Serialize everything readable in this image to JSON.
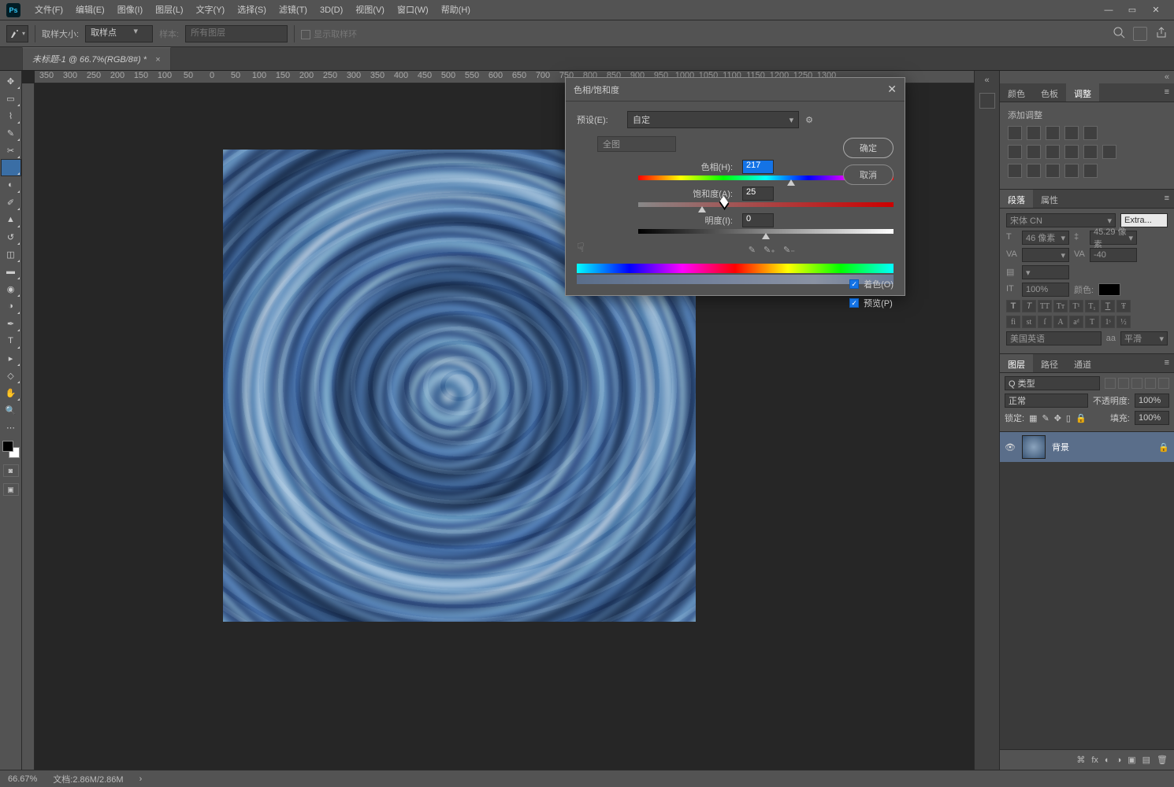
{
  "menu": {
    "items": [
      "文件(F)",
      "编辑(E)",
      "图像(I)",
      "图层(L)",
      "文字(Y)",
      "选择(S)",
      "滤镜(T)",
      "3D(D)",
      "视图(V)",
      "窗口(W)",
      "帮助(H)"
    ]
  },
  "options": {
    "sample_size_label": "取样大小:",
    "sample_size_value": "取样点",
    "sample_label": "样本:",
    "sample_value": "所有图层",
    "show_ring": "显示取样环"
  },
  "doc_tab": {
    "title": "未标题-1 @ 66.7%(RGB/8#) *"
  },
  "ruler": {
    "marks": [
      "350",
      "300",
      "250",
      "200",
      "150",
      "100",
      "50",
      "0",
      "50",
      "100",
      "150",
      "200",
      "250",
      "300",
      "350",
      "400",
      "450",
      "500",
      "550",
      "600",
      "650",
      "700",
      "750",
      "800",
      "850",
      "900",
      "950",
      "1000",
      "1050",
      "1100",
      "1150",
      "1200",
      "1250",
      "1300"
    ]
  },
  "panel_tabs": {
    "adjust": [
      "颜色",
      "色板",
      "调整"
    ],
    "prop": [
      "段落",
      "属性"
    ],
    "layers": [
      "图层",
      "路径",
      "通道"
    ]
  },
  "adjust": {
    "add_label": "添加调整"
  },
  "character": {
    "font": "宋体 CN",
    "style": "Extra...",
    "size": "46 像素",
    "leading": "45.29 像素",
    "tracking": "-40",
    "kerning": "",
    "color_label": "颜色:",
    "size_pct": "100%",
    "lang": "美国英语",
    "aa": "aa",
    "sharp": "平滑"
  },
  "layers_panel": {
    "kind": "Q 类型",
    "blend": "正常",
    "opacity_label": "不透明度:",
    "opacity": "100%",
    "lock_label": "锁定:",
    "fill_label": "填充:",
    "fill": "100%",
    "layer_name": "背景"
  },
  "status": {
    "zoom": "66.67%",
    "doc": "文档:2.86M/2.86M"
  },
  "dialog": {
    "title": "色相/饱和度",
    "preset_label": "预设(E):",
    "preset_value": "自定",
    "range": "全图",
    "hue_label": "色相(H):",
    "hue_value": "217",
    "sat_label": "饱和度(A):",
    "sat_value": "25",
    "lig_label": "明度(I):",
    "lig_value": "0",
    "ok": "确定",
    "cancel": "取消",
    "colorize": "着色(O)",
    "preview": "预览(P)"
  }
}
